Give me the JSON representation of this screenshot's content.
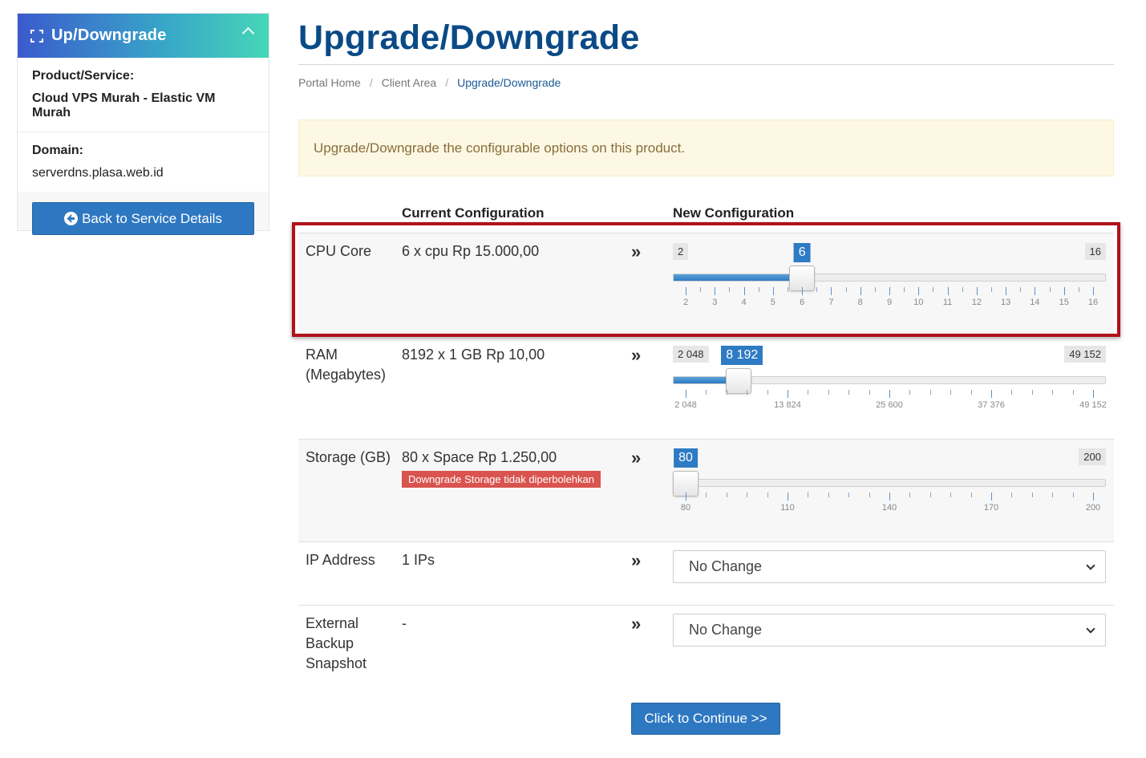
{
  "sidebar": {
    "title": "Up/Downgrade",
    "product_label": "Product/Service:",
    "product_value": "Cloud VPS Murah - Elastic VM Murah",
    "domain_label": "Domain:",
    "domain_value": "serverdns.plasa.web.id",
    "back_button": "Back to Service Details"
  },
  "page": {
    "title": "Upgrade/Downgrade",
    "breadcrumb": [
      "Portal Home",
      "Client Area",
      "Upgrade/Downgrade"
    ],
    "alert": "Upgrade/Downgrade the configurable options on this product."
  },
  "table": {
    "current_header": "Current Configuration",
    "new_header": "New Configuration",
    "arrow": "»",
    "rows": [
      {
        "name": "CPU Core",
        "current": "6 x cpu Rp 15.000,00",
        "slider": {
          "min_label": "2",
          "max_label": "16",
          "value_label": "6",
          "min": 2,
          "max": 16,
          "value": 6,
          "ticks": [
            2,
            3,
            4,
            5,
            6,
            7,
            8,
            9,
            10,
            11,
            12,
            13,
            14,
            15,
            16
          ],
          "tick_labels": [
            "2",
            "3",
            "4",
            "5",
            "6",
            "7",
            "8",
            "9",
            "10",
            "11",
            "12",
            "13",
            "14",
            "15",
            "16"
          ]
        }
      },
      {
        "name": "RAM (Megabytes)",
        "current": "8192 x 1 GB Rp 10,00",
        "slider": {
          "min_label": "2 048",
          "max_label": "49 152",
          "value_label": "8 192",
          "min": 2048,
          "max": 49152,
          "value": 8192,
          "tick_labels": [
            "2 048",
            "13 824",
            "25 600",
            "37 376",
            "49 152"
          ]
        }
      },
      {
        "name": "Storage (GB)",
        "current": "80 x Space Rp 1.250,00",
        "warning": "Downgrade Storage tidak diperbolehkan",
        "slider": {
          "max_label": "200",
          "value_label": "80",
          "min": 80,
          "max": 200,
          "value": 80,
          "tick_labels": [
            "80",
            "110",
            "140",
            "170",
            "200"
          ]
        }
      },
      {
        "name": "IP Address",
        "current": "1 IPs",
        "select": "No Change"
      },
      {
        "name": "External Backup Snapshot",
        "current": "-",
        "select": "No Change"
      }
    ]
  },
  "continue_button": "Click to Continue >>",
  "colors": {
    "primary": "#2e78c2",
    "title": "#0a4a86",
    "highlight": "#b0111b",
    "danger": "#d9534f"
  }
}
